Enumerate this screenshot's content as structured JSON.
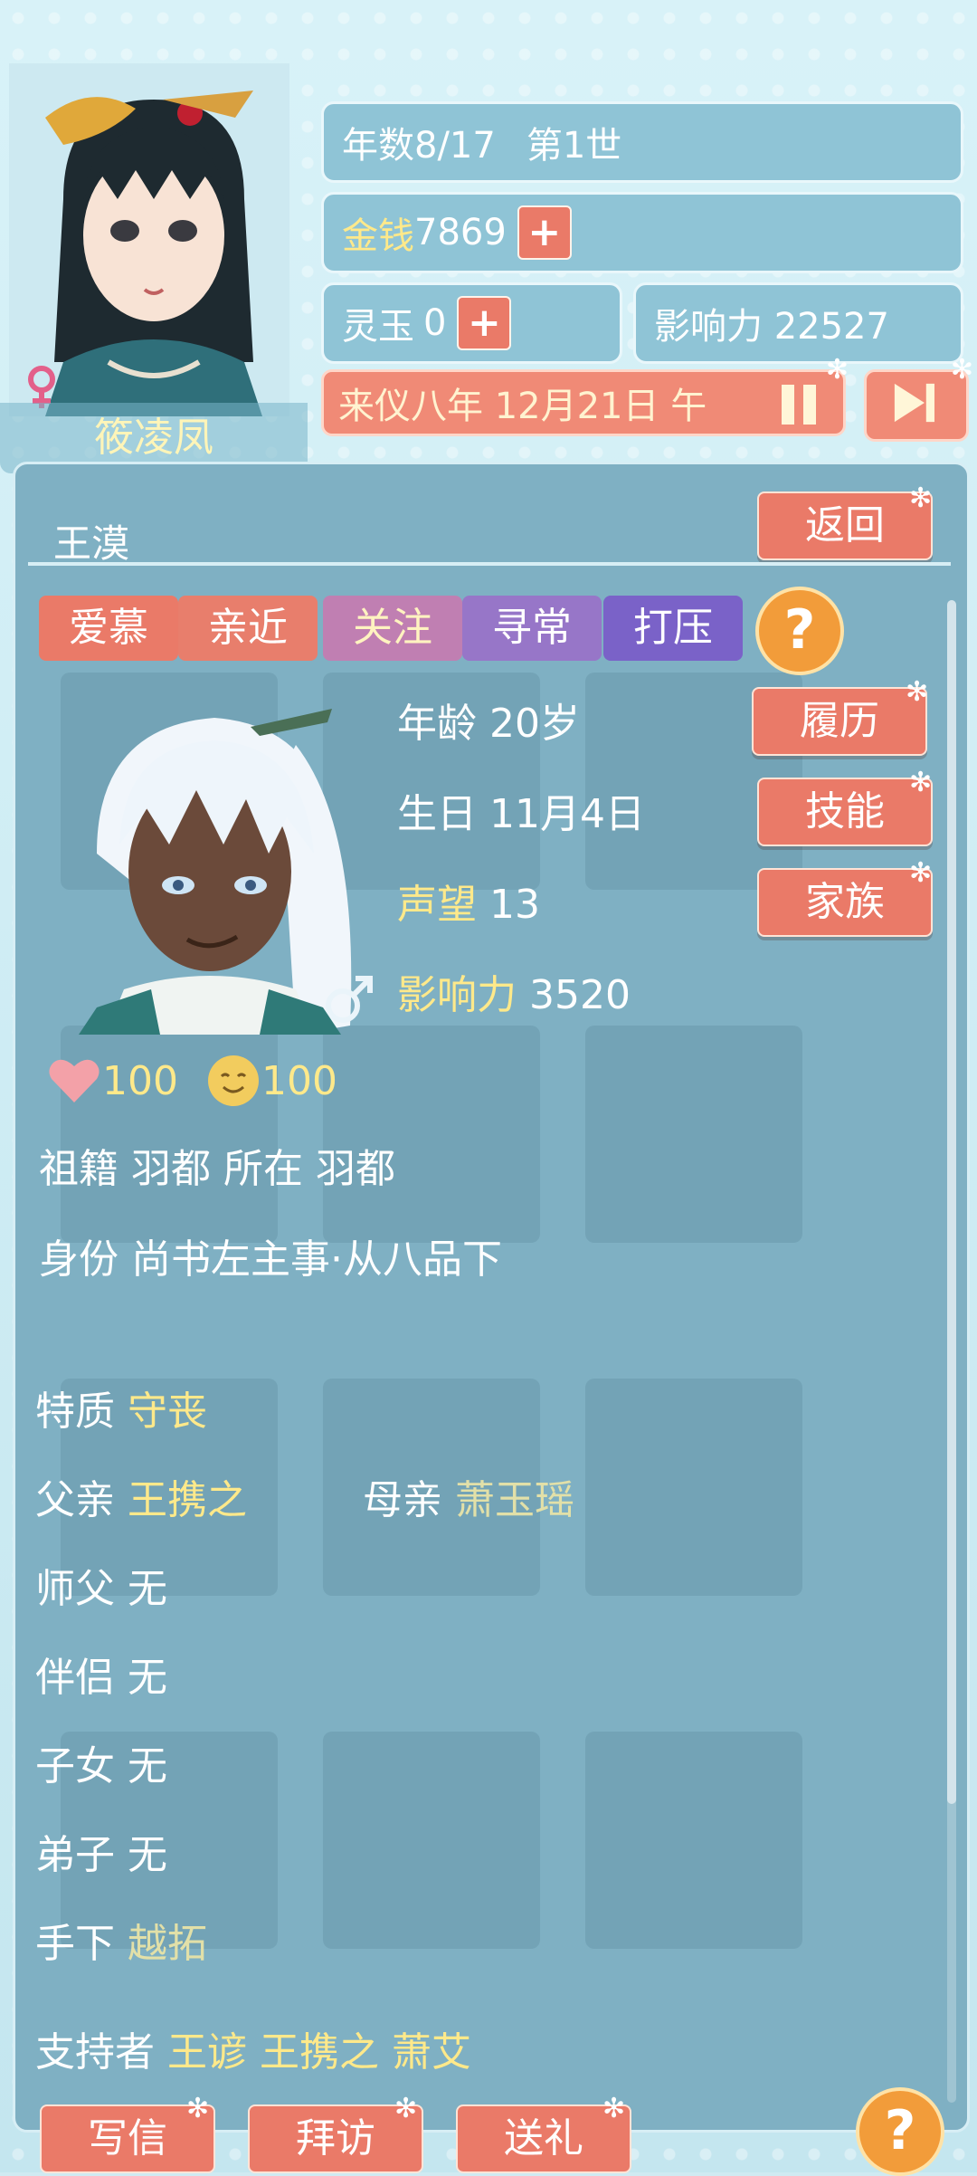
{
  "player": {
    "name": "筱凌凤",
    "year_count": "年数8/17",
    "generation": "第1世",
    "money_label": "金钱",
    "money_value": "7869",
    "jade_label": "灵玉",
    "jade_value": "0",
    "influence": "影响力 22527",
    "date": "来仪八年 12月21日 午",
    "plus_symbol": "+"
  },
  "character": {
    "name": "王漠",
    "back_label": "返回",
    "relation_tags": [
      "爱慕",
      "亲近",
      "关注",
      "寻常",
      "打压"
    ],
    "help_symbol": "?",
    "age": "年龄 20岁",
    "birthday": "生日 11月4日",
    "reputation_label": "声望",
    "reputation_value": "13",
    "influence_label": "影响力",
    "influence_value": "3520",
    "resume_label": "履历",
    "skills_label": "技能",
    "family_label": "家族",
    "favor_value": "100",
    "mood_value": "100",
    "origin": "祖籍 羽都  所在 羽都",
    "identity": "身份 尚书左主事·从八品下",
    "trait_label": "特质",
    "trait_value": "守丧",
    "father_label": "父亲",
    "father_value": "王携之",
    "mother_label": "母亲",
    "mother_value": "萧玉瑶",
    "master_label": "师父",
    "master_value": "无",
    "partner_label": "伴侣",
    "partner_value": "无",
    "children_label": "子女",
    "children_value": "无",
    "disciples_label": "弟子",
    "disciples_value": "无",
    "subordinate_label": "手下",
    "subordinate_value": "越拓",
    "supporters_label": "支持者",
    "supporters_value": "王谚 王携之 萧艾"
  },
  "bottom_actions": {
    "write_letter": "写信",
    "visit": "拜访",
    "gift": "送礼"
  },
  "colors": {
    "accent_salmon": "#ea7a68",
    "panel_blue": "#7fb0c3",
    "gold_text": "#ffe98a"
  }
}
